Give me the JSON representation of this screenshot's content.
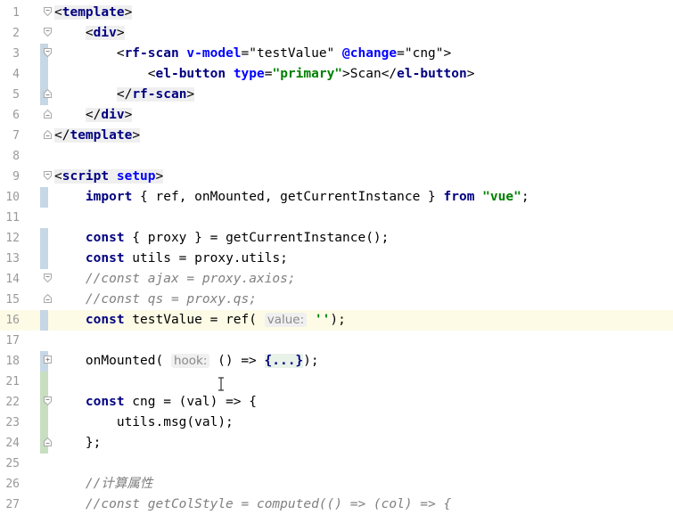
{
  "editor": {
    "lines": [
      {
        "num": "1",
        "segs": [
          {
            "t": "<",
            "c": "tagbg"
          },
          {
            "t": "template",
            "c": "kw tagbg"
          },
          {
            "t": ">",
            "c": "tagbg"
          }
        ],
        "change": "",
        "fold": "open"
      },
      {
        "num": "2",
        "segs": [
          {
            "t": "    "
          },
          {
            "t": "<",
            "c": "tagbg"
          },
          {
            "t": "div",
            "c": "kw tagbg"
          },
          {
            "t": ">",
            "c": "tagbg"
          }
        ],
        "change": "",
        "fold": "open"
      },
      {
        "num": "3",
        "segs": [
          {
            "t": "        <"
          },
          {
            "t": "rf-scan",
            "c": "kw"
          },
          {
            "t": " "
          },
          {
            "t": "v-model",
            "c": "attr"
          },
          {
            "t": "=\"testValue\" "
          },
          {
            "t": "@change",
            "c": "attr"
          },
          {
            "t": "=\"cng\">"
          }
        ],
        "change": "mod",
        "fold": "open"
      },
      {
        "num": "4",
        "segs": [
          {
            "t": "            <"
          },
          {
            "t": "el-button",
            "c": "kw"
          },
          {
            "t": " "
          },
          {
            "t": "type",
            "c": "attr"
          },
          {
            "t": "="
          },
          {
            "t": "\"primary\"",
            "c": "str"
          },
          {
            "t": ">Scan</"
          },
          {
            "t": "el-button",
            "c": "kw"
          },
          {
            "t": ">"
          }
        ],
        "change": "mod",
        "fold": ""
      },
      {
        "num": "5",
        "segs": [
          {
            "t": "        "
          },
          {
            "t": "</",
            "c": "tagbg"
          },
          {
            "t": "rf-scan",
            "c": "kw tagbg"
          },
          {
            "t": ">",
            "c": "tagbg"
          }
        ],
        "change": "mod",
        "fold": "close"
      },
      {
        "num": "6",
        "segs": [
          {
            "t": "    "
          },
          {
            "t": "</",
            "c": "tagbg"
          },
          {
            "t": "div",
            "c": "kw tagbg"
          },
          {
            "t": ">",
            "c": "tagbg"
          }
        ],
        "change": "",
        "fold": "close"
      },
      {
        "num": "7",
        "segs": [
          {
            "t": "</",
            "c": "tagbg"
          },
          {
            "t": "template",
            "c": "kw tagbg"
          },
          {
            "t": ">",
            "c": "tagbg"
          }
        ],
        "change": "",
        "fold": "close"
      },
      {
        "num": "8",
        "segs": [],
        "change": "",
        "fold": ""
      },
      {
        "num": "9",
        "segs": [
          {
            "t": "<",
            "c": "tagbg"
          },
          {
            "t": "script",
            "c": "kw tagbg"
          },
          {
            "t": " ",
            "c": "tagbg"
          },
          {
            "t": "setup",
            "c": "attr tagbg"
          },
          {
            "t": ">",
            "c": "tagbg"
          }
        ],
        "change": "",
        "fold": "open"
      },
      {
        "num": "10",
        "segs": [
          {
            "t": "    "
          },
          {
            "t": "import",
            "c": "kw"
          },
          {
            "t": " { ref, onMounted, getCurrentInstance } "
          },
          {
            "t": "from",
            "c": "kw"
          },
          {
            "t": " "
          },
          {
            "t": "\"vue\"",
            "c": "str"
          },
          {
            "t": ";"
          }
        ],
        "change": "mod",
        "fold": ""
      },
      {
        "num": "11",
        "segs": [],
        "change": "",
        "fold": ""
      },
      {
        "num": "12",
        "segs": [
          {
            "t": "    "
          },
          {
            "t": "const",
            "c": "kw"
          },
          {
            "t": " { proxy } = getCurrentInstance();"
          }
        ],
        "change": "mod",
        "fold": ""
      },
      {
        "num": "13",
        "segs": [
          {
            "t": "    "
          },
          {
            "t": "const",
            "c": "kw"
          },
          {
            "t": " utils = proxy.utils;"
          }
        ],
        "change": "mod",
        "fold": ""
      },
      {
        "num": "14",
        "segs": [
          {
            "t": "    "
          },
          {
            "t": "//const ajax = proxy.axios;",
            "c": "cm"
          }
        ],
        "change": "",
        "fold": "open"
      },
      {
        "num": "15",
        "segs": [
          {
            "t": "    "
          },
          {
            "t": "//const qs = proxy.qs;",
            "c": "cm"
          }
        ],
        "change": "",
        "fold": "close"
      },
      {
        "num": "16",
        "segs": [
          {
            "t": "    "
          },
          {
            "t": "const",
            "c": "kw"
          },
          {
            "t": " testValue = ref( "
          },
          {
            "t": "value:",
            "c": "hint"
          },
          {
            "t": " "
          },
          {
            "t": "''",
            "c": "str"
          },
          {
            "t": ");"
          }
        ],
        "change": "mod",
        "fold": "",
        "current": true
      },
      {
        "num": "17",
        "segs": [],
        "change": "",
        "fold": ""
      },
      {
        "num": "18",
        "segs": [
          {
            "t": "    onMounted( "
          },
          {
            "t": "hook:",
            "c": "hint"
          },
          {
            "t": " () => "
          },
          {
            "t": "{...}",
            "c": "foldtext"
          },
          {
            "t": ");"
          }
        ],
        "change": "mod",
        "fold": "plus"
      },
      {
        "num": "21",
        "segs": [],
        "change": "add",
        "fold": ""
      },
      {
        "num": "22",
        "segs": [
          {
            "t": "    "
          },
          {
            "t": "const",
            "c": "kw"
          },
          {
            "t": " cng = (val) => {"
          }
        ],
        "change": "add",
        "fold": "open"
      },
      {
        "num": "23",
        "segs": [
          {
            "t": "        utils.msg(val);"
          }
        ],
        "change": "add",
        "fold": ""
      },
      {
        "num": "24",
        "segs": [
          {
            "t": "    };"
          }
        ],
        "change": "add",
        "fold": "close"
      },
      {
        "num": "25",
        "segs": [],
        "change": "",
        "fold": ""
      },
      {
        "num": "26",
        "segs": [
          {
            "t": "    "
          },
          {
            "t": "//计算属性",
            "c": "cm"
          }
        ],
        "change": "",
        "fold": ""
      },
      {
        "num": "27",
        "segs": [
          {
            "t": "    "
          },
          {
            "t": "//const getColStyle = computed(() => (col) => {",
            "c": "cm"
          }
        ],
        "change": "",
        "fold": ""
      }
    ]
  }
}
